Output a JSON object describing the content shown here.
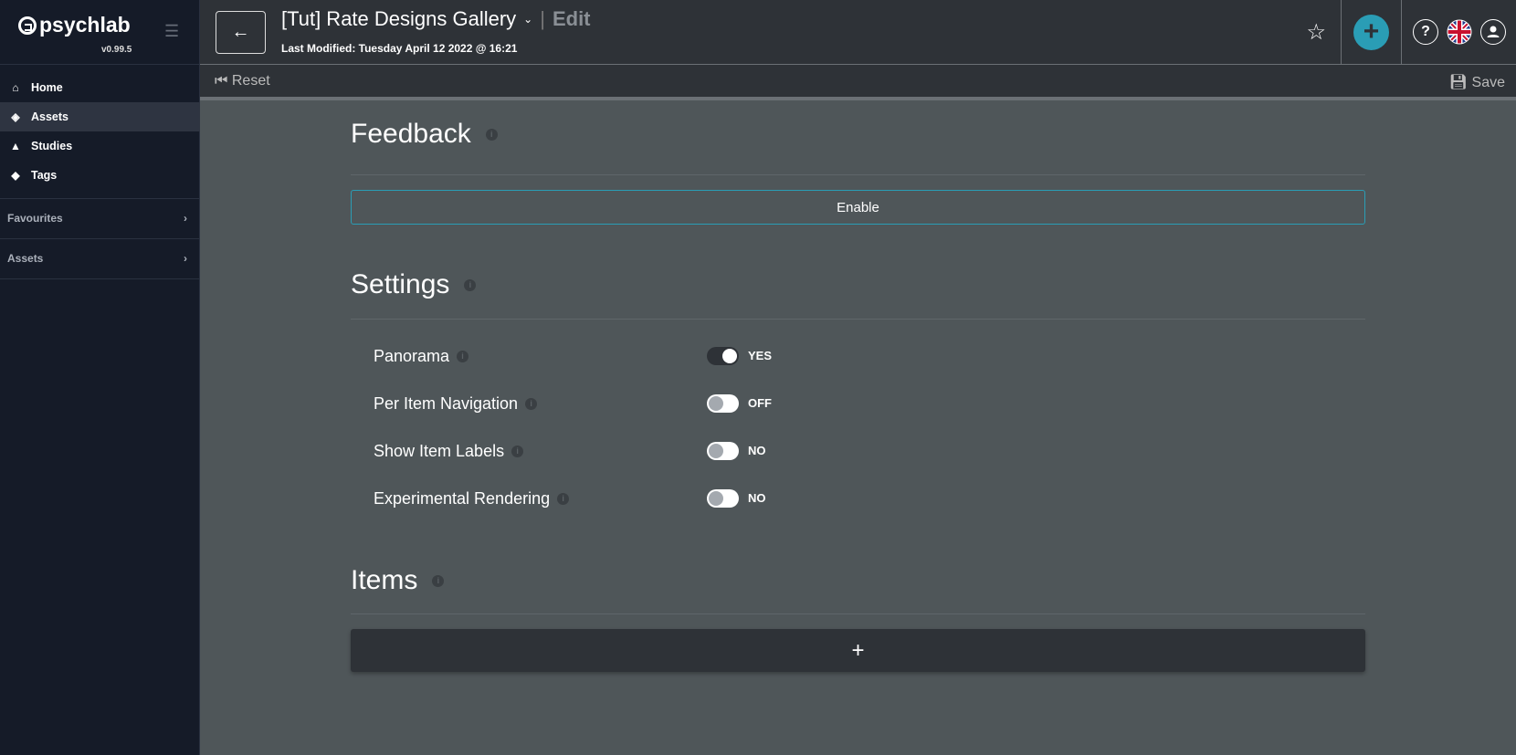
{
  "sidebar": {
    "brand": "psychlab",
    "version": "v0.99.5",
    "nav": [
      {
        "label": "Home",
        "icon": "home-icon"
      },
      {
        "label": "Assets",
        "icon": "layers-icon",
        "active": true
      },
      {
        "label": "Studies",
        "icon": "rocket-icon"
      },
      {
        "label": "Tags",
        "icon": "tags-icon"
      }
    ],
    "groups": [
      {
        "label": "Favourites"
      },
      {
        "label": "Assets"
      }
    ]
  },
  "header": {
    "title": "[Tut] Rate Designs Gallery",
    "separator": "|",
    "mode": "Edit",
    "last_modified": "Last Modified: Tuesday April 12 2022 @ 16:21"
  },
  "toolbar": {
    "reset": "Reset",
    "save": "Save"
  },
  "feedback": {
    "heading": "Feedback",
    "enable": "Enable"
  },
  "settings": {
    "heading": "Settings",
    "rows": [
      {
        "label": "Panorama",
        "on": true,
        "state": "YES"
      },
      {
        "label": "Per Item Navigation",
        "on": false,
        "state": "OFF"
      },
      {
        "label": "Show Item Labels",
        "on": false,
        "state": "NO"
      },
      {
        "label": "Experimental Rendering",
        "on": false,
        "state": "NO"
      }
    ]
  },
  "items": {
    "heading": "Items",
    "add": "+"
  },
  "colors": {
    "accent": "#2a9db5",
    "sidebar": "#151b28",
    "header": "#2e3237",
    "content": "#4f5659"
  }
}
